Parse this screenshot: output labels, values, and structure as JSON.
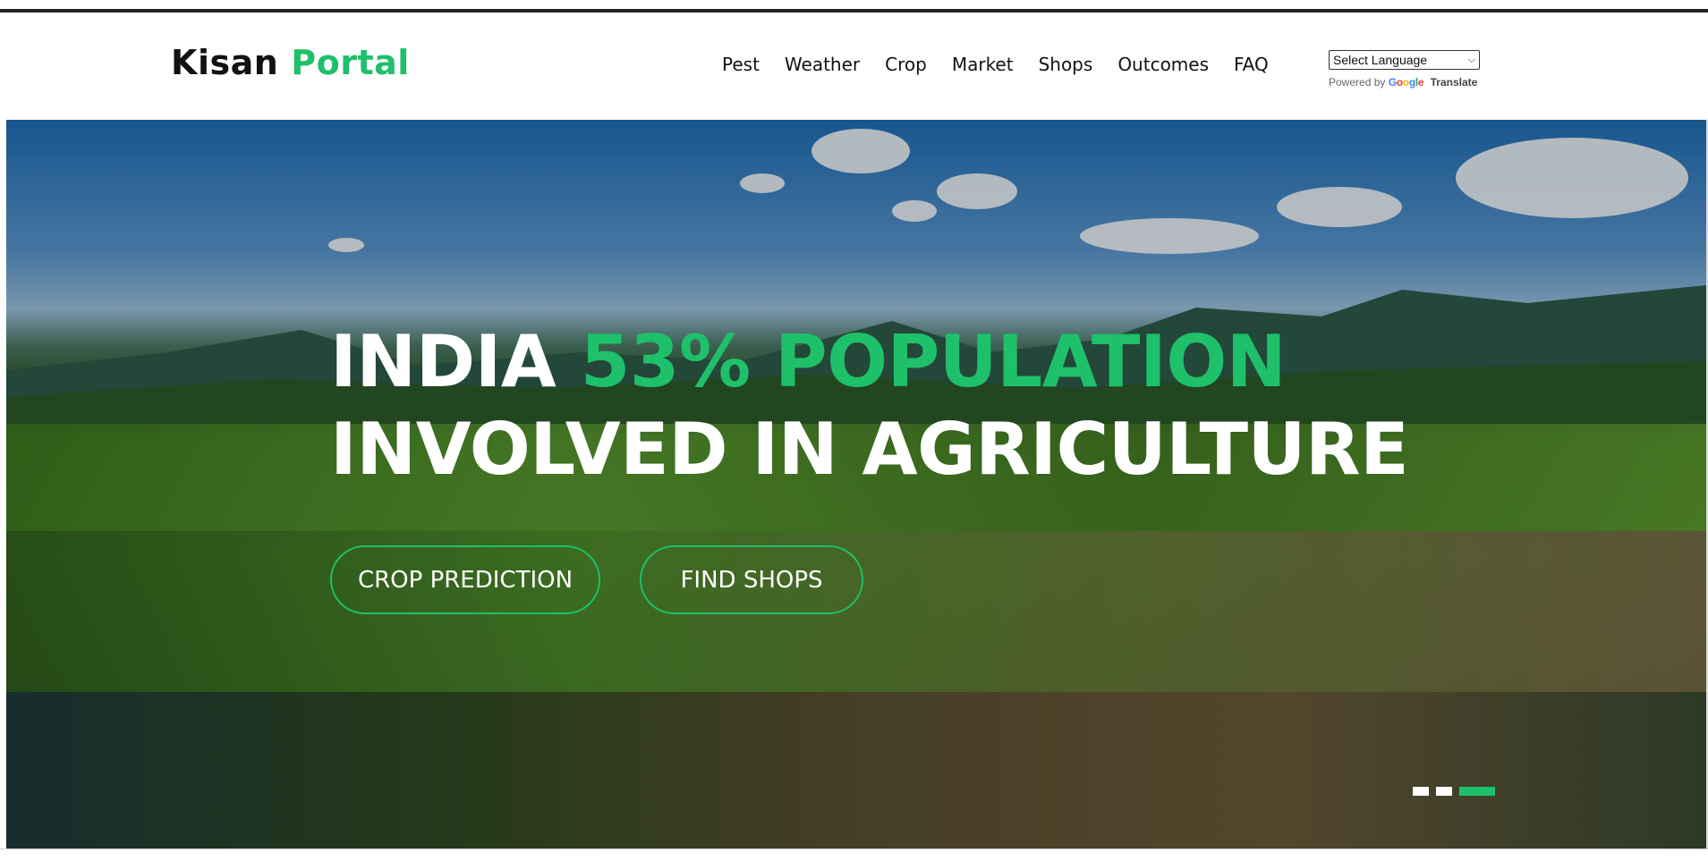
{
  "brand": {
    "name": "Kisan",
    "accent": "Portal"
  },
  "nav": {
    "items": [
      "Pest",
      "Weather",
      "Crop",
      "Market",
      "Shops",
      "Outcomes",
      "FAQ"
    ]
  },
  "translate": {
    "select_label": "Select Language",
    "powered_by": "Powered by",
    "google": [
      "G",
      "o",
      "o",
      "g",
      "l",
      "e"
    ],
    "translate_label": "Translate"
  },
  "hero": {
    "line1_white": "INDIA ",
    "line1_green": "53% POPULATION",
    "line2": "INVOLVED IN AGRICULTURE",
    "button1": "CROP PREDICTION",
    "button2": "FIND SHOPS",
    "slides": {
      "count": 3,
      "active": 3
    }
  },
  "colors": {
    "accent": "#1fc06a",
    "text": "#111111",
    "white": "#ffffff"
  }
}
